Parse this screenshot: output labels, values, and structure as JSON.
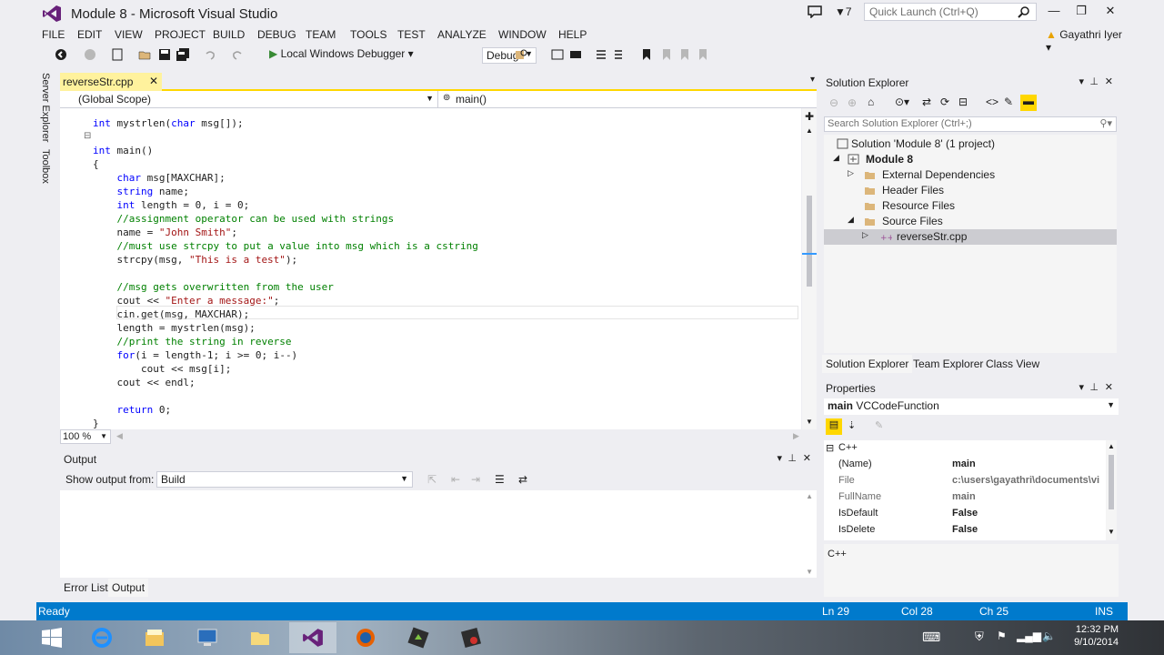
{
  "window": {
    "title": "Module 8 - Microsoft Visual Studio",
    "notification_count": "7",
    "quick_launch_placeholder": "Quick Launch (Ctrl+Q)",
    "user": "Gayathri Iyer"
  },
  "menu": [
    "FILE",
    "EDIT",
    "VIEW",
    "PROJECT",
    "BUILD",
    "DEBUG",
    "TEAM",
    "TOOLS",
    "TEST",
    "ANALYZE",
    "WINDOW",
    "HELP"
  ],
  "toolbar": {
    "debugger": "Local Windows Debugger",
    "configuration": "Debug"
  },
  "rail": {
    "server_explorer": "Server Explorer",
    "toolbox": "Toolbox"
  },
  "editor": {
    "file_tab": "reverseStr.cpp",
    "scope_left": "(Global Scope)",
    "scope_right": "main()",
    "zoom": "100 %",
    "code_lines": [
      "int mystrlen(char msg[]);",
      "",
      "int main()",
      "{",
      "    char msg[MAXCHAR];",
      "    string name;",
      "    int length = 0, i = 0;",
      "    //assignment operator can be used with strings",
      "    name = \"John Smith\";",
      "    //must use strcpy to put a value into msg which is a cstring",
      "    strcpy(msg, \"This is a test\");",
      "",
      "    //msg gets overwritten from the user",
      "    cout << \"Enter a message:\";",
      "    cin.get(msg, MAXCHAR);",
      "    length = mystrlen(msg);",
      "    //print the string in reverse",
      "    for(i = length-1; i >= 0; i--)",
      "        cout << msg[i];",
      "    cout << endl;",
      "",
      "    return 0;",
      "}"
    ]
  },
  "output": {
    "title": "Output",
    "show_from_label": "Show output from:",
    "source": "Build",
    "tabs": [
      "Error List",
      "Output"
    ]
  },
  "solution_explorer": {
    "title": "Solution Explorer",
    "search_placeholder": "Search Solution Explorer (Ctrl+;)",
    "tree": [
      "Solution 'Module 8' (1 project)",
      "Module 8",
      "External Dependencies",
      "Header Files",
      "Resource Files",
      "Source Files",
      "reverseStr.cpp"
    ],
    "tabs": [
      "Solution Explorer",
      "Team Explorer",
      "Class View"
    ]
  },
  "properties": {
    "title": "Properties",
    "object_name": "main",
    "object_type": "VCCodeFunction",
    "category": "C++",
    "rows": [
      {
        "name": "(Name)",
        "value": "main"
      },
      {
        "name": "File",
        "value": "c:\\users\\gayathri\\documents\\vi"
      },
      {
        "name": "FullName",
        "value": "main"
      },
      {
        "name": "IsDefault",
        "value": "False"
      },
      {
        "name": "IsDelete",
        "value": "False"
      }
    ],
    "description": "C++"
  },
  "status": {
    "state": "Ready",
    "line": "Ln 29",
    "col": "Col 28",
    "ch": "Ch 25",
    "mode": "INS"
  },
  "taskbar": {
    "time": "12:32 PM",
    "date": "9/10/2014"
  },
  "colors": {
    "status_bar": "#007acc",
    "tab_active": "#fff29d",
    "keyword": "#0000ff",
    "comment": "#008000",
    "string": "#a31515"
  }
}
